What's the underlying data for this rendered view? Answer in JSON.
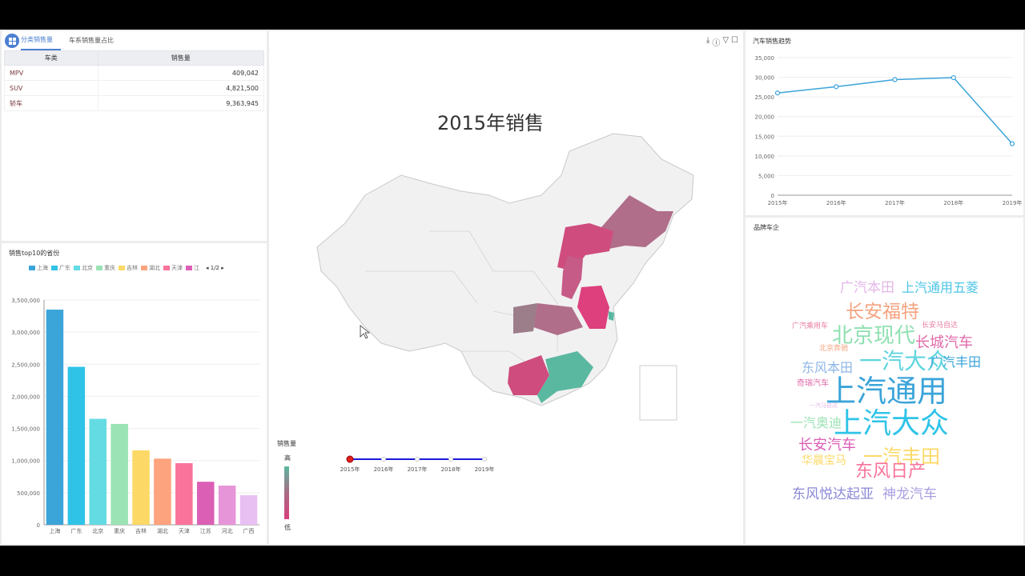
{
  "table_panel": {
    "tabs": [
      "分类销售量",
      "车系销售量占比"
    ],
    "columns": [
      "车类",
      "销售量"
    ],
    "rows": [
      {
        "type": "MPV",
        "sales": "409,042"
      },
      {
        "type": "SUV",
        "sales": "4,821,500"
      },
      {
        "type": "轿车",
        "sales": "9,363,945"
      }
    ]
  },
  "bar_panel": {
    "title": "销售top10的省份",
    "legend": [
      "上海",
      "广东",
      "北京",
      "重庆",
      "吉林",
      "湖北",
      "天津",
      "江"
    ],
    "legend_pager": "1/2",
    "colors": [
      "#3ba4d9",
      "#2fc3e8",
      "#64dbe3",
      "#9be2b4",
      "#fcd966",
      "#fda37d",
      "#f9739a",
      "#dc5fb6",
      "#e695d8",
      "#e8c0f2"
    ]
  },
  "map_panel": {
    "title": "2015年销售",
    "visual_map": {
      "title": "销售量",
      "high": "高",
      "low": "低"
    },
    "timeline": [
      "2015年",
      "2016年",
      "2017年",
      "2018年",
      "2019年"
    ],
    "timeline_current": "2015年"
  },
  "line_panel": {
    "title": "汽车销售趋势",
    "color": "#3ba4d9"
  },
  "cloud_panel": {
    "title": "品牌车企",
    "words": [
      {
        "text": "广汽本田",
        "size": 17,
        "color": "#e4b7e8"
      },
      {
        "text": "上汽通用五菱",
        "size": 16,
        "color": "#4cc4e6"
      },
      {
        "text": "长安福特",
        "size": 23,
        "color": "#f5a37f"
      },
      {
        "text": "广汽乘用车",
        "size": 9,
        "color": "#e97aa0"
      },
      {
        "text": "长安马自达",
        "size": 9,
        "color": "#e97aa0"
      },
      {
        "text": "北京现代",
        "size": 26,
        "color": "#8fe0b0"
      },
      {
        "text": "长城汽车",
        "size": 18,
        "color": "#e06aa8"
      },
      {
        "text": "北京奔驰",
        "size": 9,
        "color": "#f5a37f"
      },
      {
        "text": "一汽大众",
        "size": 28,
        "color": "#5fd5e0"
      },
      {
        "text": "东风本田",
        "size": 16,
        "color": "#8eb6e6"
      },
      {
        "text": "广汽丰田",
        "size": 16,
        "color": "#3ba4d9"
      },
      {
        "text": "奇瑞汽车",
        "size": 10,
        "color": "#e06aa8"
      },
      {
        "text": "上汽通用",
        "size": 38,
        "color": "#3ba4d9"
      },
      {
        "text": "一汽马自达",
        "size": 7,
        "color": "#e4b7e8"
      },
      {
        "text": "一汽奥迪",
        "size": 16,
        "color": "#9be2b4"
      },
      {
        "text": "上汽大众",
        "size": 36,
        "color": "#2fc3e8"
      },
      {
        "text": "长安汽车",
        "size": 18,
        "color": "#dc5fb6"
      },
      {
        "text": "一汽丰田",
        "size": 24,
        "color": "#fcd966"
      },
      {
        "text": "华晨宝马",
        "size": 14,
        "color": "#fcd966"
      },
      {
        "text": "东风日产",
        "size": 22,
        "color": "#f9739a"
      },
      {
        "text": "东风悦达起亚",
        "size": 17,
        "color": "#8a88d6"
      },
      {
        "text": "神龙汽车",
        "size": 17,
        "color": "#a99fe0"
      }
    ]
  },
  "chart_data": [
    {
      "type": "bar",
      "title": "销售top10的省份",
      "categories": [
        "上海",
        "广东",
        "北京",
        "重庆",
        "吉林",
        "湖北",
        "天津",
        "江苏",
        "河北",
        "广西"
      ],
      "values": [
        3350000,
        2460000,
        1650000,
        1570000,
        1160000,
        1030000,
        960000,
        670000,
        610000,
        460000
      ],
      "ylim": [
        0,
        3500000
      ],
      "yticks": [
        "0",
        "500,000",
        "1,000,000",
        "1,500,000",
        "2,000,000",
        "2,500,000",
        "3,000,000",
        "3,500,000"
      ],
      "xlabel": "",
      "ylabel": ""
    },
    {
      "type": "line",
      "title": "汽车销售趋势",
      "x": [
        "2015年",
        "2016年",
        "2017年",
        "2018年",
        "2019年"
      ],
      "values": [
        26000,
        27600,
        29400,
        29900,
        13100
      ],
      "ylim": [
        0,
        35000
      ],
      "yticks": [
        "0",
        "5,000",
        "10,000",
        "15,000",
        "20,000",
        "25,000",
        "30,000",
        "35,000"
      ],
      "xlabel": "",
      "ylabel": ""
    }
  ]
}
